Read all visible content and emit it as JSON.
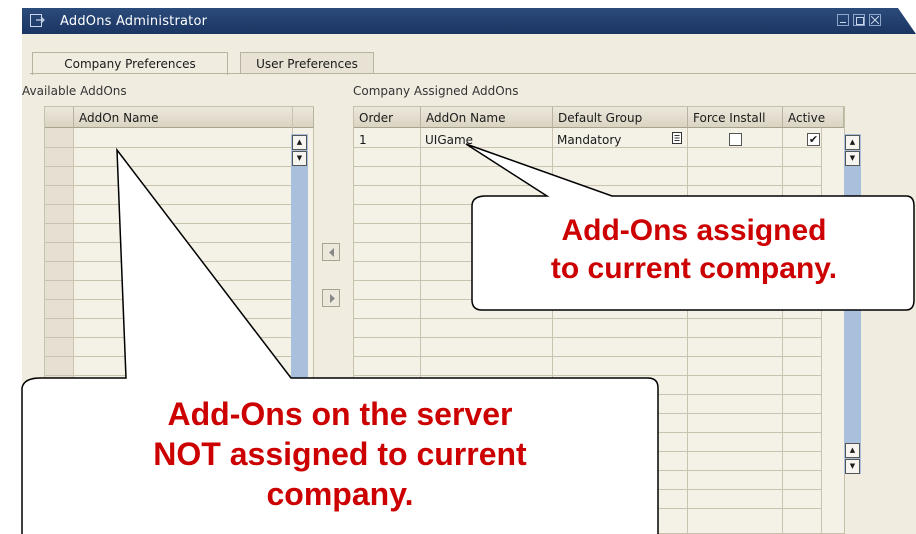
{
  "window": {
    "title": "AddOns Administrator"
  },
  "tabs": [
    {
      "label": "Company Preferences"
    },
    {
      "label": "User Preferences"
    }
  ],
  "available": {
    "section_label": "Available AddOns",
    "columns": [
      "AddOn Name"
    ]
  },
  "assigned": {
    "section_label": "Company Assigned AddOns",
    "columns": [
      "Order",
      "AddOn Name",
      "Default Group",
      "Force Install",
      "Active"
    ],
    "rows": [
      {
        "order": "1",
        "name": "UIGame",
        "group": "Mandatory",
        "force_install": false,
        "active": true
      }
    ]
  },
  "callouts": {
    "assigned_line1": "Add-Ons assigned",
    "assigned_line2": "to current company.",
    "available_line1": "Add-Ons on the server",
    "available_line2": "NOT assigned to current",
    "available_line3": "company."
  },
  "colors": {
    "callout_text": "#cc0000",
    "titlebar": "#1f3a68",
    "scrollbar": "#a8c0dc"
  }
}
